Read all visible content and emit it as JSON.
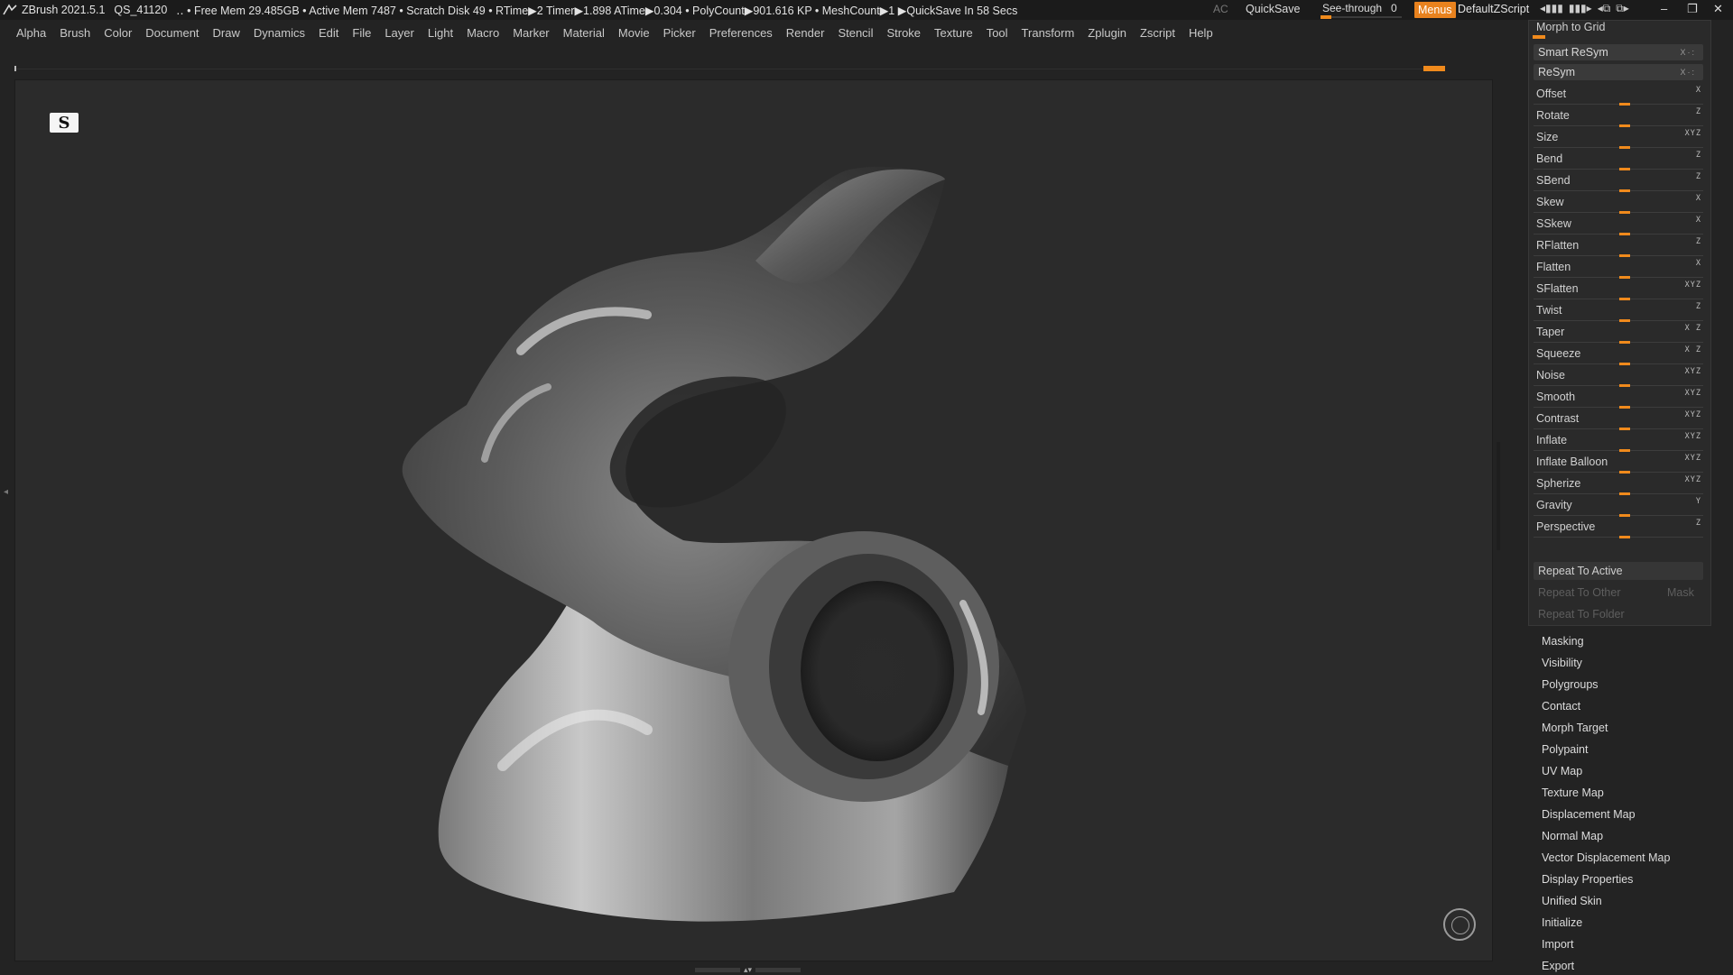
{
  "titlebar": {
    "app": "ZBrush 2021.5.1",
    "doc": "QS_41120",
    "stats": "‥ • Free Mem 29.485GB • Active Mem 7487 • Scratch Disk 49 •  RTime▶2 Timer▶1.898 ATime▶0.304 • PolyCount▶901.616 KP  • MeshCount▶1  ▶QuickSave In 58 Secs",
    "ac": "AC",
    "quicksave": "QuickSave",
    "seethrough_label": "See-through",
    "seethrough_value": "0",
    "seethrough_fraction": 0.0,
    "menus": "Menus",
    "default_zscript": "DefaultZScript",
    "accent_color": "#f08a1c"
  },
  "menubar": [
    "Alpha",
    "Brush",
    "Color",
    "Document",
    "Draw",
    "Dynamics",
    "Edit",
    "File",
    "Layer",
    "Light",
    "Macro",
    "Marker",
    "Material",
    "Movie",
    "Picker",
    "Preferences",
    "Render",
    "Stencil",
    "Stroke",
    "Texture",
    "Tool",
    "Transform",
    "Zplugin",
    "Zscript",
    "Help"
  ],
  "deformation": {
    "morph_to_grid": "Morph to Grid",
    "smart_resym": "Smart ReSym",
    "resym": "ReSym",
    "sliders": [
      {
        "label": "Offset",
        "xyz": "X  "
      },
      {
        "label": "Rotate",
        "xyz": "  Z"
      },
      {
        "label": "Size",
        "xyz": "XYZ"
      },
      {
        "label": "Bend",
        "xyz": "  Z"
      },
      {
        "label": "SBend",
        "xyz": "  Z"
      },
      {
        "label": "Skew",
        "xyz": "X  "
      },
      {
        "label": "SSkew",
        "xyz": "X  "
      },
      {
        "label": "RFlatten",
        "xyz": "  Z"
      },
      {
        "label": "Flatten",
        "xyz": "X  "
      },
      {
        "label": "SFlatten",
        "xyz": "XYZ"
      },
      {
        "label": "Twist",
        "xyz": "  Z"
      },
      {
        "label": "Taper",
        "xyz": "X Z"
      },
      {
        "label": "Squeeze",
        "xyz": "X Z"
      },
      {
        "label": "Noise",
        "xyz": "XYZ"
      },
      {
        "label": "Smooth",
        "xyz": "XYZ"
      },
      {
        "label": "Contrast",
        "xyz": "XYZ"
      },
      {
        "label": "Inflate",
        "xyz": "XYZ"
      },
      {
        "label": "Inflate Balloon",
        "xyz": "XYZ"
      },
      {
        "label": "Spherize",
        "xyz": "XYZ"
      },
      {
        "label": "Gravity",
        "xyz": " Y "
      },
      {
        "label": "Perspective",
        "xyz": "  Z"
      }
    ],
    "repeat_to_active": "Repeat To Active",
    "repeat_to_other": "Repeat To Other",
    "mask": "Mask",
    "repeat_to_folder": "Repeat To Folder"
  },
  "subpalettes": [
    "Masking",
    "Visibility",
    "Polygroups",
    "Contact",
    "Morph Target",
    "Polypaint",
    "UV Map",
    "Texture Map",
    "Displacement Map",
    "Normal Map",
    "Vector Displacement Map",
    "Display Properties",
    "Unified Skin",
    "Initialize",
    "Import",
    "Export"
  ],
  "viewport": {
    "logo_glyph": "S",
    "gizmo_icon": "navigation-gizmo-icon"
  }
}
